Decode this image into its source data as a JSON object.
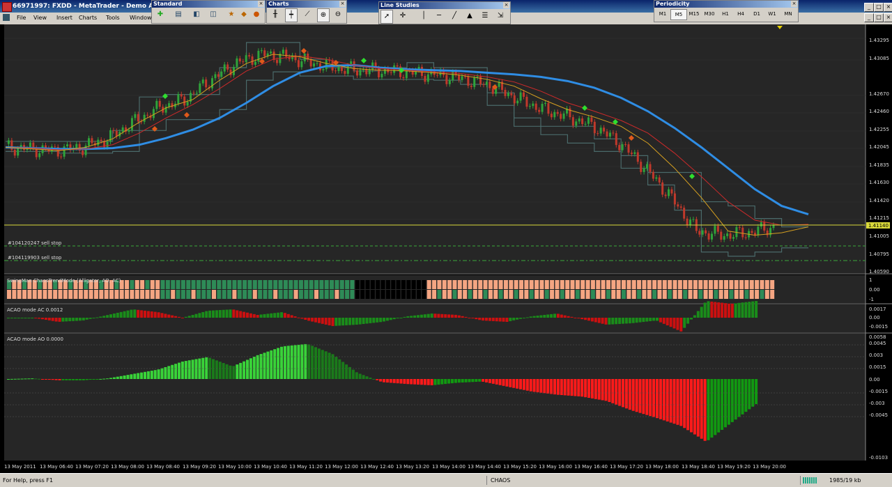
{
  "window": {
    "title": "66971997: FXDD - MetaTrader - Demo Acco"
  },
  "menu": [
    "File",
    "View",
    "Insert",
    "Charts",
    "Tools",
    "Window"
  ],
  "toolbars": {
    "standard": {
      "title": "Standard"
    },
    "charts": {
      "title": "Charts"
    },
    "line_studies": {
      "title": "Line Studies"
    },
    "periodicity": {
      "title": "Periodicity",
      "items": [
        "M1",
        "M5",
        "M15",
        "M30",
        "H1",
        "H4",
        "D1",
        "W1",
        "MN"
      ],
      "active": "M5"
    }
  },
  "colors": {
    "chart_bg": "#262626",
    "bull": "#2fa33a",
    "bear": "#c0392b",
    "ma_slow": "#2f8de4",
    "ma_mid": "#cc2a2a",
    "ma_fast": "#d6a020",
    "envelope": "#4a6a6a",
    "price_line": "#d9d93a",
    "ao_up": "#39d339",
    "ao_dn": "#ff1a1a",
    "stop_line": "#39a839"
  },
  "main_chart": {
    "price_scale": [
      "1.43295",
      "1.43085",
      "1.42670",
      "1.42460",
      "1.42255",
      "1.42045",
      "1.41835",
      "1.41630",
      "1.41420",
      "1.41215",
      "1.41005",
      "1.40795",
      "1.40590"
    ],
    "current_price": "1.41140",
    "orders": [
      {
        "label": "#104120247 sell stop"
      },
      {
        "label": "#104119903 sell stop"
      }
    ]
  },
  "indicators": {
    "swingman": {
      "label": "SwingMan ChaosTrendMode (Alligator, AO, AC)",
      "scale": [
        "1",
        "0.00",
        "-1"
      ]
    },
    "ac": {
      "label": "ACAO mode AC  0.0012",
      "scale": [
        "0.0017",
        "0.00",
        "-0.0015"
      ]
    },
    "ao": {
      "label": "ACAO mode AO  0.0000",
      "scale": [
        "0.0058",
        "0.0045",
        "0.003",
        "0.0015",
        "0.00",
        "-0.0015",
        "-0.003",
        "-0.0045",
        "-0.0103"
      ]
    }
  },
  "time_axis": [
    "13 May 2011",
    "13 May 06:40",
    "13 May 07:20",
    "13 May 08:00",
    "13 May 08:40",
    "13 May 09:20",
    "13 May 10:00",
    "13 May 10:40",
    "13 May 11:20",
    "13 May 12:00",
    "13 May 12:40",
    "13 May 13:20",
    "13 May 14:00",
    "13 May 14:40",
    "13 May 15:20",
    "13 May 16:00",
    "13 May 16:40",
    "13 May 17:20",
    "13 May 18:00",
    "13 May 18:40",
    "13 May 19:20",
    "13 May 20:00"
  ],
  "status": {
    "help": "For Help, press F1",
    "profile": "CHAOS",
    "traffic": "1985/19 kb"
  },
  "chart_data": {
    "type": "line",
    "symbol_timeframe": "M5",
    "price_ylim": [
      1.4059,
      1.4335
    ],
    "series": [
      {
        "values": [
          1.4205,
          1.4204,
          1.4203,
          1.4203,
          1.4204,
          1.4208,
          1.4216,
          1.4226,
          1.424,
          1.4258,
          1.4278,
          1.4294,
          1.4302,
          1.4303,
          1.43,
          1.4298,
          1.4297,
          1.4296,
          1.4294,
          1.4292,
          1.4289,
          1.4284,
          1.4276,
          1.4264,
          1.4248,
          1.4228,
          1.4205,
          1.418,
          1.4155,
          1.4135,
          1.4125
        ]
      },
      {
        "values": [
          1.4205,
          1.4204,
          1.4202,
          1.4203,
          1.4208,
          1.4222,
          1.424,
          1.4256,
          1.4275,
          1.4296,
          1.431,
          1.4314,
          1.431,
          1.4303,
          1.4299,
          1.4297,
          1.4295,
          1.4293,
          1.4289,
          1.4283,
          1.4272,
          1.4258,
          1.4248,
          1.4237,
          1.4222,
          1.4198,
          1.417,
          1.414,
          1.4118,
          1.4112,
          1.4113
        ]
      },
      {
        "values": [
          1.4205,
          1.4203,
          1.4201,
          1.4205,
          1.4215,
          1.4235,
          1.4252,
          1.4262,
          1.4285,
          1.4305,
          1.4316,
          1.4313,
          1.4305,
          1.4299,
          1.4297,
          1.4296,
          1.4294,
          1.4291,
          1.4286,
          1.4278,
          1.4263,
          1.425,
          1.4241,
          1.423,
          1.421,
          1.418,
          1.4145,
          1.4105,
          1.41,
          1.4103,
          1.411
        ]
      }
    ],
    "ao_values": [
      0.0,
      0.0001,
      -0.0002,
      -0.0002,
      0.0001,
      0.0008,
      0.0015,
      0.0028,
      0.0035,
      0.002,
      0.0038,
      0.0052,
      0.0056,
      0.004,
      0.001,
      -0.0005,
      -0.0008,
      -0.001,
      -0.0006,
      -0.0004,
      -0.0012,
      -0.002,
      -0.0025,
      -0.0028,
      -0.0035,
      -0.005,
      -0.0062,
      -0.0075,
      -0.01,
      -0.007,
      -0.004
    ],
    "ac_values": [
      0.0,
      0.0,
      -0.0003,
      -0.0002,
      0.0002,
      0.0006,
      0.0004,
      0.0,
      0.0005,
      0.0006,
      0.0002,
      0.0004,
      -0.0002,
      -0.0006,
      -0.0005,
      -0.0003,
      0.0001,
      0.0003,
      0.0002,
      -0.0002,
      -0.0003,
      0.0001,
      0.0003,
      -0.0001,
      -0.0005,
      -0.0004,
      -0.0002,
      -0.001,
      0.0012,
      0.001,
      0.0012
    ]
  }
}
